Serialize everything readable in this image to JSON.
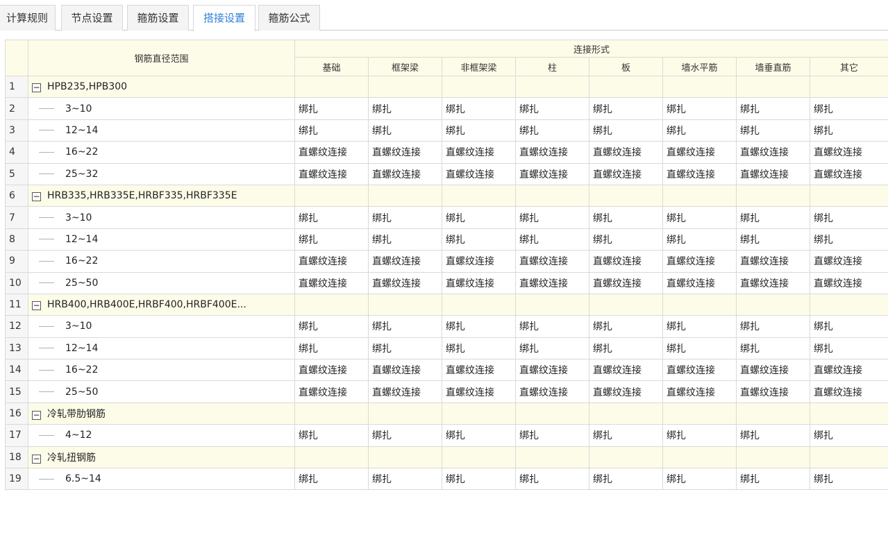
{
  "tabs": [
    {
      "label": "计算规则",
      "active": false
    },
    {
      "label": "节点设置",
      "active": false
    },
    {
      "label": "箍筋设置",
      "active": false
    },
    {
      "label": "搭接设置",
      "active": true
    },
    {
      "label": "箍筋公式",
      "active": false
    }
  ],
  "header": {
    "diameter_range": "钢筋直径范围",
    "connection_form": "连接形式",
    "columns": [
      "基础",
      "框架梁",
      "非框架梁",
      "柱",
      "板",
      "墙水平筋",
      "墙垂直筋",
      "其它"
    ]
  },
  "rows": [
    {
      "num": "1",
      "label": "HPB235,HPB300",
      "group": true,
      "cells": [
        "",
        "",
        "",
        "",
        "",
        "",
        "",
        ""
      ]
    },
    {
      "num": "2",
      "label": "3~10",
      "group": false,
      "cells": [
        "绑扎",
        "绑扎",
        "绑扎",
        "绑扎",
        "绑扎",
        "绑扎",
        "绑扎",
        "绑扎"
      ]
    },
    {
      "num": "3",
      "label": "12~14",
      "group": false,
      "cells": [
        "绑扎",
        "绑扎",
        "绑扎",
        "绑扎",
        "绑扎",
        "绑扎",
        "绑扎",
        "绑扎"
      ]
    },
    {
      "num": "4",
      "label": "16~22",
      "group": false,
      "cells": [
        "直螺纹连接",
        "直螺纹连接",
        "直螺纹连接",
        "直螺纹连接",
        "直螺纹连接",
        "直螺纹连接",
        "直螺纹连接",
        "直螺纹连接"
      ]
    },
    {
      "num": "5",
      "label": "25~32",
      "group": false,
      "cells": [
        "直螺纹连接",
        "直螺纹连接",
        "直螺纹连接",
        "直螺纹连接",
        "直螺纹连接",
        "直螺纹连接",
        "直螺纹连接",
        "直螺纹连接"
      ]
    },
    {
      "num": "6",
      "label": "HRB335,HRB335E,HRBF335,HRBF335E",
      "group": true,
      "cells": [
        "",
        "",
        "",
        "",
        "",
        "",
        "",
        ""
      ]
    },
    {
      "num": "7",
      "label": "3~10",
      "group": false,
      "cells": [
        "绑扎",
        "绑扎",
        "绑扎",
        "绑扎",
        "绑扎",
        "绑扎",
        "绑扎",
        "绑扎"
      ]
    },
    {
      "num": "8",
      "label": "12~14",
      "group": false,
      "cells": [
        "绑扎",
        "绑扎",
        "绑扎",
        "绑扎",
        "绑扎",
        "绑扎",
        "绑扎",
        "绑扎"
      ]
    },
    {
      "num": "9",
      "label": "16~22",
      "group": false,
      "cells": [
        "直螺纹连接",
        "直螺纹连接",
        "直螺纹连接",
        "直螺纹连接",
        "直螺纹连接",
        "直螺纹连接",
        "直螺纹连接",
        "直螺纹连接"
      ]
    },
    {
      "num": "10",
      "label": "25~50",
      "group": false,
      "cells": [
        "直螺纹连接",
        "直螺纹连接",
        "直螺纹连接",
        "直螺纹连接",
        "直螺纹连接",
        "直螺纹连接",
        "直螺纹连接",
        "直螺纹连接"
      ]
    },
    {
      "num": "11",
      "label": "HRB400,HRB400E,HRBF400,HRBF400E...",
      "group": true,
      "cells": [
        "",
        "",
        "",
        "",
        "",
        "",
        "",
        ""
      ]
    },
    {
      "num": "12",
      "label": "3~10",
      "group": false,
      "cells": [
        "绑扎",
        "绑扎",
        "绑扎",
        "绑扎",
        "绑扎",
        "绑扎",
        "绑扎",
        "绑扎"
      ]
    },
    {
      "num": "13",
      "label": "12~14",
      "group": false,
      "cells": [
        "绑扎",
        "绑扎",
        "绑扎",
        "绑扎",
        "绑扎",
        "绑扎",
        "绑扎",
        "绑扎"
      ]
    },
    {
      "num": "14",
      "label": "16~22",
      "group": false,
      "cells": [
        "直螺纹连接",
        "直螺纹连接",
        "直螺纹连接",
        "直螺纹连接",
        "直螺纹连接",
        "直螺纹连接",
        "直螺纹连接",
        "直螺纹连接"
      ]
    },
    {
      "num": "15",
      "label": "25~50",
      "group": false,
      "cells": [
        "直螺纹连接",
        "直螺纹连接",
        "直螺纹连接",
        "直螺纹连接",
        "直螺纹连接",
        "直螺纹连接",
        "直螺纹连接",
        "直螺纹连接"
      ]
    },
    {
      "num": "16",
      "label": "冷轧带肋钢筋",
      "group": true,
      "cells": [
        "",
        "",
        "",
        "",
        "",
        "",
        "",
        ""
      ]
    },
    {
      "num": "17",
      "label": "4~12",
      "group": false,
      "cells": [
        "绑扎",
        "绑扎",
        "绑扎",
        "绑扎",
        "绑扎",
        "绑扎",
        "绑扎",
        "绑扎"
      ]
    },
    {
      "num": "18",
      "label": "冷轧扭钢筋",
      "group": true,
      "cells": [
        "",
        "",
        "",
        "",
        "",
        "",
        "",
        ""
      ]
    },
    {
      "num": "19",
      "label": "6.5~14",
      "group": false,
      "cells": [
        "绑扎",
        "绑扎",
        "绑扎",
        "绑扎",
        "绑扎",
        "绑扎",
        "绑扎",
        "绑扎"
      ]
    }
  ],
  "icons": {
    "expander": "collapse-minus-icon",
    "expander_glyph": "−"
  },
  "colors": {
    "active_tab": "#2f7fd8",
    "group_row_bg": "#fdfce8",
    "border": "#d9d9d9"
  }
}
